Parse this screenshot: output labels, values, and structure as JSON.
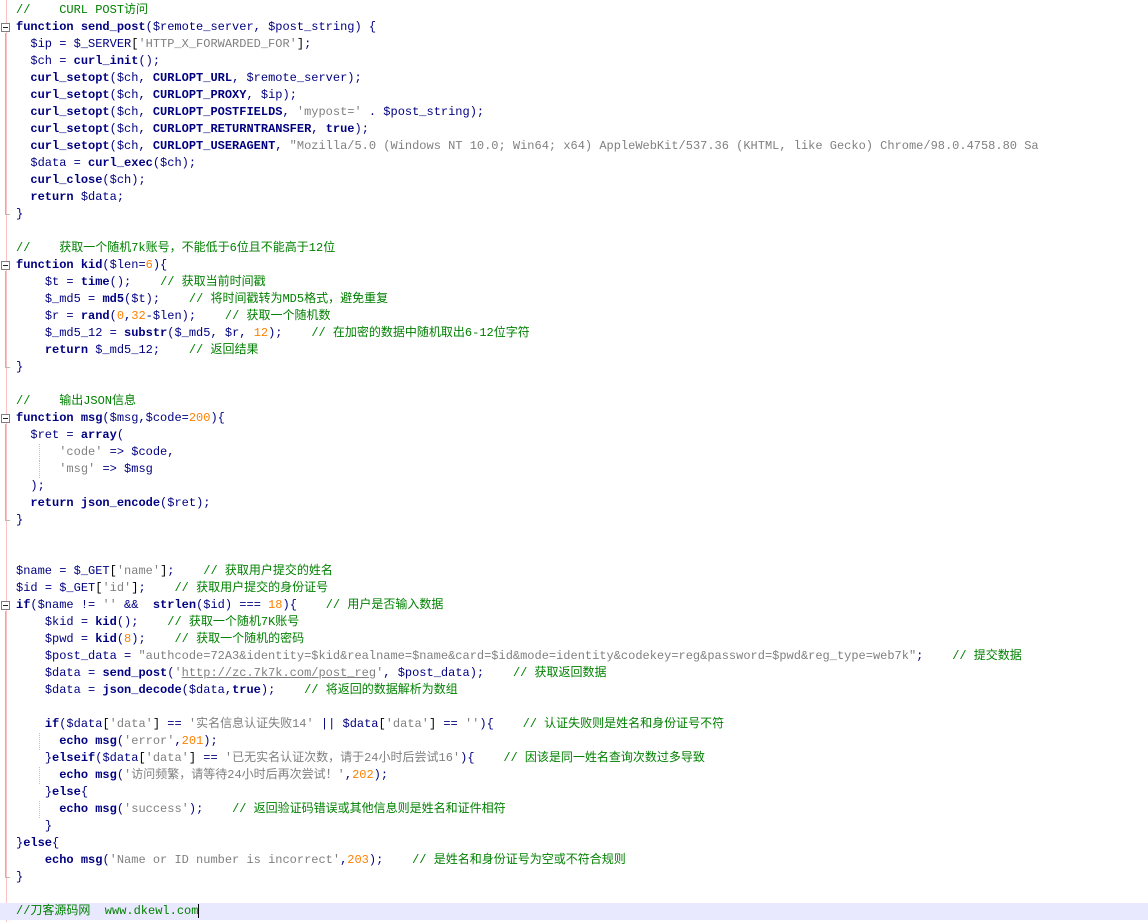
{
  "editor": {
    "lines": [
      {
        "t": "//    CURL POST访问",
        "k": "comment"
      },
      {
        "t": "function send_post($remote_server, $post_string) {",
        "k": "code"
      },
      {
        "t": "  $ip = $_SERVER['HTTP_X_FORWARDED_FOR'];",
        "k": "code"
      },
      {
        "t": "  $ch = curl_init();",
        "k": "code"
      },
      {
        "t": "  curl_setopt($ch, CURLOPT_URL, $remote_server);",
        "k": "code"
      },
      {
        "t": "  curl_setopt($ch, CURLOPT_PROXY, $ip);",
        "k": "code"
      },
      {
        "t": "  curl_setopt($ch, CURLOPT_POSTFIELDS, 'mypost=' . $post_string);",
        "k": "code"
      },
      {
        "t": "  curl_setopt($ch, CURLOPT_RETURNTRANSFER, true);",
        "k": "code"
      },
      {
        "t": "  curl_setopt($ch, CURLOPT_USERAGENT, \"Mozilla/5.0 (Windows NT 10.0; Win64; x64) AppleWebKit/537.36 (KHTML, like Gecko) Chrome/98.0.4758.80 Sa",
        "k": "code"
      },
      {
        "t": "  $data = curl_exec($ch);",
        "k": "code"
      },
      {
        "t": "  curl_close($ch);",
        "k": "code"
      },
      {
        "t": "  return $data;",
        "k": "code"
      },
      {
        "t": "}",
        "k": "code"
      },
      {
        "t": "",
        "k": "blank"
      },
      {
        "t": "//    获取一个随机7k账号，不能低于6位且不能高于12位",
        "k": "comment"
      },
      {
        "t": "function kid($len=6){",
        "k": "code"
      },
      {
        "t": "    $t = time();    // 获取当前时间戳",
        "k": "code"
      },
      {
        "t": "    $_md5 = md5($t);    // 将时间戳转为MD5格式，避免重复",
        "k": "code"
      },
      {
        "t": "    $r = rand(0,32-$len);    // 获取一个随机数",
        "k": "code"
      },
      {
        "t": "    $_md5_12 = substr($_md5, $r, 12);    // 在加密的数据中随机取出6-12位字符",
        "k": "code"
      },
      {
        "t": "    return $_md5_12;    // 返回结果",
        "k": "code"
      },
      {
        "t": "}",
        "k": "code"
      },
      {
        "t": "",
        "k": "blank"
      },
      {
        "t": "//    输出JSON信息",
        "k": "comment"
      },
      {
        "t": "function msg($msg,$code=200){",
        "k": "code"
      },
      {
        "t": "  $ret = array(",
        "k": "code"
      },
      {
        "t": "      'code' => $code,",
        "k": "code"
      },
      {
        "t": "      'msg' => $msg",
        "k": "code"
      },
      {
        "t": "  );",
        "k": "code"
      },
      {
        "t": "  return json_encode($ret);",
        "k": "code"
      },
      {
        "t": "}",
        "k": "code"
      },
      {
        "t": "",
        "k": "blank"
      },
      {
        "t": "",
        "k": "blank"
      },
      {
        "t": "$name = $_GET['name'];    // 获取用户提交的姓名",
        "k": "code"
      },
      {
        "t": "$id = $_GET['id'];    // 获取用户提交的身份证号",
        "k": "code"
      },
      {
        "t": "if($name != '' &&  strlen($id) === 18){    // 用户是否输入数据",
        "k": "code"
      },
      {
        "t": "    $kid = kid();    // 获取一个随机7K账号",
        "k": "code"
      },
      {
        "t": "    $pwd = kid(8);    // 获取一个随机的密码",
        "k": "code"
      },
      {
        "t": "    $post_data = \"authcode=72A3&identity=$kid&realname=$name&card=$id&mode=identity&codekey=reg&password=$pwd&reg_type=web7k\";    // 提交数据",
        "k": "code"
      },
      {
        "t": "    $data = send_post('http://zc.7k7k.com/post_reg', $post_data);    // 获取返回数据",
        "k": "code"
      },
      {
        "t": "    $data = json_decode($data,true);    // 将返回的数据解析为数组",
        "k": "code"
      },
      {
        "t": "",
        "k": "blank"
      },
      {
        "t": "    if($data['data'] == '实名信息认证失败14' || $data['data'] == ''){    // 认证失败则是姓名和身份证号不符",
        "k": "code"
      },
      {
        "t": "      echo msg('error',201);",
        "k": "code"
      },
      {
        "t": "    }elseif($data['data'] == '已无实名认证次数，请于24小时后尝试16'){    // 因该是同一姓名查询次数过多导致",
        "k": "code"
      },
      {
        "t": "      echo msg('访问频繁，请等待24小时后再次尝试！',202);",
        "k": "code"
      },
      {
        "t": "    }else{",
        "k": "code"
      },
      {
        "t": "      echo msg('success');    // 返回验证码错误或其他信息则是姓名和证件相符",
        "k": "code"
      },
      {
        "t": "    }",
        "k": "code"
      },
      {
        "t": "}else{",
        "k": "code"
      },
      {
        "t": "    echo msg('Name or ID number is incorrect',203);    // 是姓名和身份证号为空或不符合规则",
        "k": "code"
      },
      {
        "t": "}",
        "k": "code"
      },
      {
        "t": "",
        "k": "blank"
      },
      {
        "t": "//刀客源码网  www.dkewl.com",
        "k": "comment"
      }
    ]
  },
  "colors": {
    "keyword": "#000080",
    "string": "#808080",
    "number": "#ff8000",
    "comment": "#008000",
    "caret_line": "#e8e8ff"
  }
}
